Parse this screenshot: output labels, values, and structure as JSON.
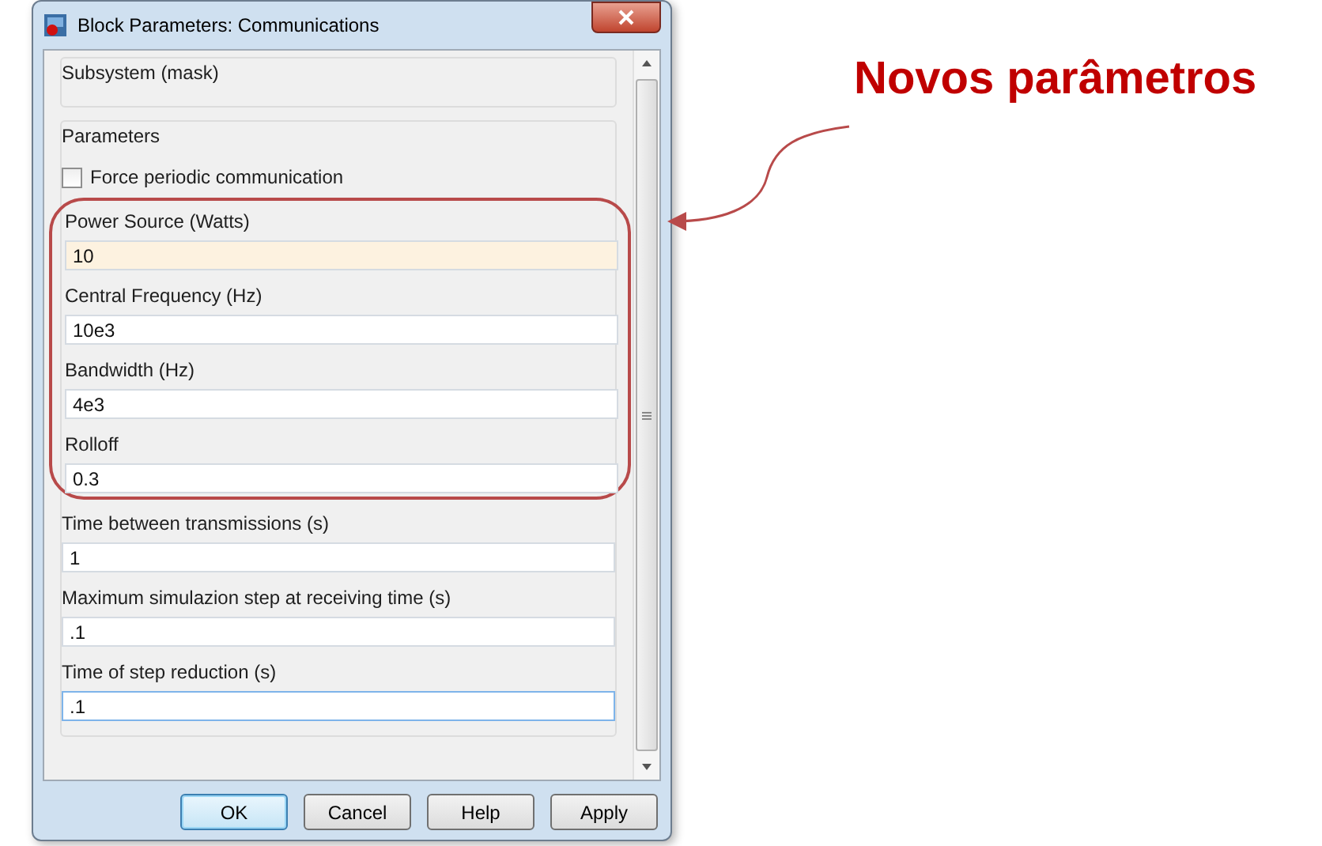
{
  "window": {
    "title": "Block Parameters: Communications"
  },
  "mask": {
    "title": "Subsystem (mask)"
  },
  "parameters": {
    "title": "Parameters",
    "checkbox": {
      "label": "Force periodic communication",
      "checked": false
    },
    "fields": [
      {
        "label": "Power Source (Watts)",
        "value": "10",
        "highlighted": true,
        "focused": false,
        "circled": true
      },
      {
        "label": "Central Frequency (Hz)",
        "value": "10e3",
        "highlighted": false,
        "focused": false,
        "circled": true
      },
      {
        "label": "Bandwidth (Hz)",
        "value": "4e3",
        "highlighted": false,
        "focused": false,
        "circled": true
      },
      {
        "label": "Rolloff",
        "value": "0.3",
        "highlighted": false,
        "focused": false,
        "circled": true
      },
      {
        "label": "Time between transmissions (s)",
        "value": "1",
        "highlighted": false,
        "focused": false,
        "circled": false
      },
      {
        "label": "Maximum simulazion step at receiving time (s)",
        "value": ".1",
        "highlighted": false,
        "focused": false,
        "circled": false
      },
      {
        "label": "Time of step reduction (s)",
        "value": ".1",
        "highlighted": false,
        "focused": true,
        "circled": false
      }
    ]
  },
  "buttons": [
    {
      "label": "OK",
      "default": true
    },
    {
      "label": "Cancel",
      "default": false
    },
    {
      "label": "Help",
      "default": false
    },
    {
      "label": "Apply",
      "default": false
    }
  ],
  "annotation": {
    "text": "Novos parâmetros"
  }
}
